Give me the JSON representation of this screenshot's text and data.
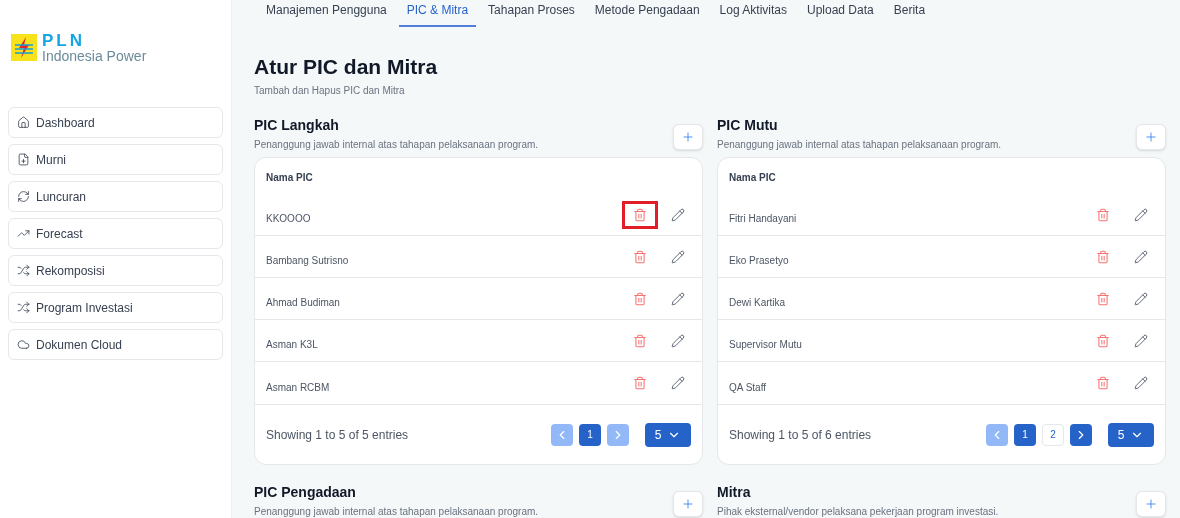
{
  "logo": {
    "brand": "PLN",
    "subtitle": "Indonesia Power"
  },
  "sidebar": {
    "items": [
      {
        "label": "Dashboard",
        "selected": false
      },
      {
        "label": "Murni",
        "selected": false
      },
      {
        "label": "Luncuran",
        "selected": false
      },
      {
        "label": "Forecast",
        "selected": false
      },
      {
        "label": "Rekomposisi",
        "selected": false
      },
      {
        "label": "Program Investasi",
        "selected": false
      },
      {
        "label": "Dokumen Cloud",
        "selected": false
      }
    ]
  },
  "tabs": [
    {
      "label": "Manajemen Pengguna",
      "selected": false
    },
    {
      "label": "PIC & Mitra",
      "selected": true
    },
    {
      "label": "Tahapan Proses",
      "selected": false
    },
    {
      "label": "Metode Pengadaan",
      "selected": false
    },
    {
      "label": "Log Aktivitas",
      "selected": false
    },
    {
      "label": "Upload Data",
      "selected": false
    },
    {
      "label": "Berita",
      "selected": false
    }
  ],
  "page": {
    "title": "Atur PIC dan Mitra",
    "subtitle": "Tambah dan Hapus PIC dan Mitra"
  },
  "sections": [
    {
      "title": "PIC Langkah",
      "description": "Penanggung jawab internal atas tahapan pelaksanaan program.",
      "table": {
        "column": "Nama PIC",
        "rows": [
          {
            "name": "KKOOOO",
            "highlighted": true
          },
          {
            "name": "Bambang Sutrisno",
            "highlighted": false
          },
          {
            "name": "Ahmad Budiman",
            "highlighted": false
          },
          {
            "name": "Asman K3L",
            "highlighted": false
          },
          {
            "name": "Asman RCBM",
            "highlighted": false
          }
        ],
        "info": "Showing 1 to 5 of 5 entries",
        "prev_disabled": true,
        "next_disabled": true,
        "pages": [
          {
            "label": "1",
            "selected": true
          }
        ],
        "page_size": "5"
      }
    },
    {
      "title": "PIC Mutu",
      "description": "Penanggung jawab internal atas tahapan pelaksanaan program.",
      "table": {
        "column": "Nama PIC",
        "rows": [
          {
            "name": "Fitri Handayani",
            "highlighted": false
          },
          {
            "name": "Eko Prasetyo",
            "highlighted": false
          },
          {
            "name": "Dewi Kartika",
            "highlighted": false
          },
          {
            "name": "Supervisor Mutu",
            "highlighted": false
          },
          {
            "name": "QA Staff",
            "highlighted": false
          }
        ],
        "info": "Showing 1 to 5 of 6 entries",
        "prev_disabled": true,
        "next_disabled": false,
        "pages": [
          {
            "label": "1",
            "selected": true
          },
          {
            "label": "2",
            "selected": false
          }
        ],
        "page_size": "5"
      }
    },
    {
      "title": "PIC Pengadaan",
      "description": "Penanggung jawab internal atas tahapan pelaksanaan program."
    },
    {
      "title": "Mitra",
      "description": "Pihak eksternal/vendor pelaksana pekerjaan program investasi."
    }
  ]
}
